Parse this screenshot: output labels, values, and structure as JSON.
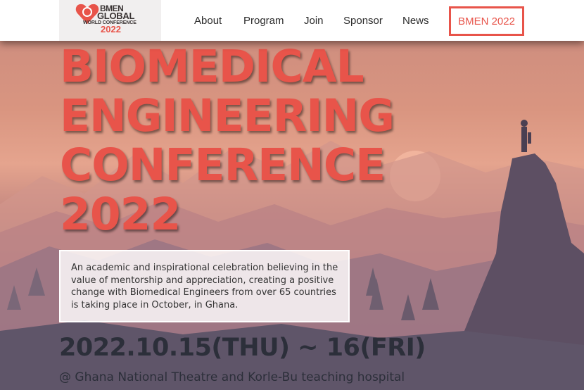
{
  "nav": {
    "logo": {
      "line1": "BMEN",
      "line2": "GLOBAL",
      "line3": "WORLD CONFERENCE",
      "line4": "2022"
    },
    "items": [
      "About",
      "Program",
      "Join",
      "Sponsor",
      "News"
    ],
    "cta": "BMEN 2022"
  },
  "hero": {
    "title_lines": [
      "BIOMEDICAL",
      "ENGINEERING",
      "CONFERENCE",
      "2022"
    ],
    "description": "An academic and inspirational celebration believing in the value of mentorship and appreciation, creating a positive change with Biomedical Engineers from over 65 countries is taking place in October, in Ghana.",
    "date": "2022.10.15(THU) ~ 16(FRI)",
    "venue": "@ Ghana National Theatre and Korle-Bu teaching hospital"
  },
  "colors": {
    "accent": "#e8544a",
    "text_dark": "#2c2f3a",
    "nav_bg": "#ffffff"
  }
}
